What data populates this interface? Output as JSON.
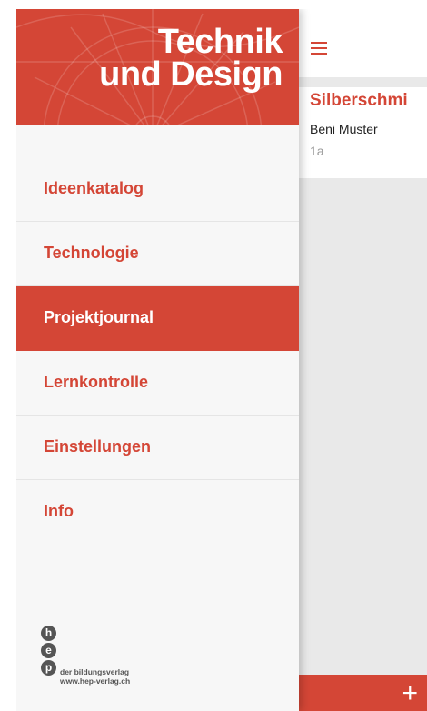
{
  "brand": {
    "line1": "Technik",
    "line2": "und Design"
  },
  "nav": {
    "items": [
      {
        "label": "Ideenkatalog",
        "active": false
      },
      {
        "label": "Technologie",
        "active": false
      },
      {
        "label": "Projektjournal",
        "active": true
      },
      {
        "label": "Lernkontrolle",
        "active": false
      },
      {
        "label": "Einstellungen",
        "active": false
      },
      {
        "label": "Info",
        "active": false
      }
    ]
  },
  "publisher": {
    "letters": [
      "h",
      "e",
      "p"
    ],
    "name": "der bildungsverlag",
    "url": "www.hep-verlag.ch"
  },
  "main": {
    "project": {
      "title": "Silberschmi",
      "author": "Beni Muster",
      "class": "1a"
    },
    "add_icon": "plus-icon",
    "menu_icon": "hamburger-icon"
  },
  "colors": {
    "accent": "#d44636",
    "background": "#ececec"
  }
}
